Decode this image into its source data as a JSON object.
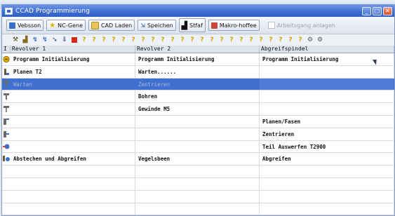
{
  "window": {
    "title": "CCAD Programmierung",
    "controls": [
      "minimize",
      "maximize",
      "close"
    ]
  },
  "toolbar": {
    "buttons": [
      {
        "label": "Vebsson",
        "icon": "vector-icon"
      },
      {
        "label": "NC-Gene",
        "icon": "star-icon"
      },
      {
        "label": "CAD Laden",
        "icon": "folder-icon"
      },
      {
        "label": "Speichen",
        "icon": "save-icon"
      },
      {
        "label": "Stfaf",
        "icon": "chart-icon"
      },
      {
        "label": "Makro-hoffee",
        "icon": "macro-icon"
      }
    ],
    "checkbox_label": "Arbeitsgang anlagen"
  },
  "tool_icons": [
    "tool-icon",
    "arrow-icon",
    "arrow-icon",
    "arrow-icon",
    "arrow-icon",
    "stop-icon",
    "?",
    "?",
    "?",
    "?",
    "?",
    "?",
    "?",
    "?",
    "?",
    "?",
    "?",
    "?",
    "?",
    "?",
    "?",
    "?",
    "?",
    "?",
    "?",
    "?",
    "?",
    "gear-icon",
    "gear-icon"
  ],
  "grid": {
    "headers": [
      "I",
      "Revolver 1",
      "Revolver 2",
      "Abgreifspindel"
    ],
    "rows": [
      {
        "icon": "program-icon",
        "cells": [
          "Programm Initialisierung",
          "Programm Initialisierung",
          "Programm Initialisierung"
        ]
      },
      {
        "icon": "plane-icon",
        "cells": [
          "Planen T2",
          "Warten......",
          ""
        ]
      },
      {
        "icon": "drill-icon",
        "cells": [
          "Warten",
          "Zentrieren",
          ""
        ],
        "selected": true
      },
      {
        "icon": "drill-icon",
        "cells": [
          "",
          "Bohren",
          ""
        ]
      },
      {
        "icon": "thread-icon",
        "cells": [
          "",
          "Gewinde M5",
          ""
        ]
      },
      {
        "icon": "face-icon",
        "cells": [
          "",
          "",
          "Planen/Fasen"
        ]
      },
      {
        "icon": "center-icon",
        "cells": [
          "",
          "",
          "Zentrieren"
        ]
      },
      {
        "icon": "eject-icon",
        "cells": [
          "",
          "",
          "Teil Auswerfen T2900"
        ]
      },
      {
        "icon": "cutoff-icon",
        "cells": [
          "Abstechen und Abgreifen",
          "Vegelsbeen",
          "Abgreifen"
        ]
      },
      {
        "icon": "",
        "cells": [
          "",
          "",
          ""
        ]
      },
      {
        "icon": "",
        "cells": [
          "",
          "",
          ""
        ]
      },
      {
        "icon": "",
        "cells": [
          "",
          "",
          ""
        ]
      },
      {
        "icon": "",
        "cells": [
          "",
          "",
          ""
        ]
      }
    ]
  },
  "colors": {
    "selection": "#3f6fcf",
    "titlebar": "#3f6fd3",
    "question": "#c7a400",
    "stop": "#d32b1e"
  }
}
